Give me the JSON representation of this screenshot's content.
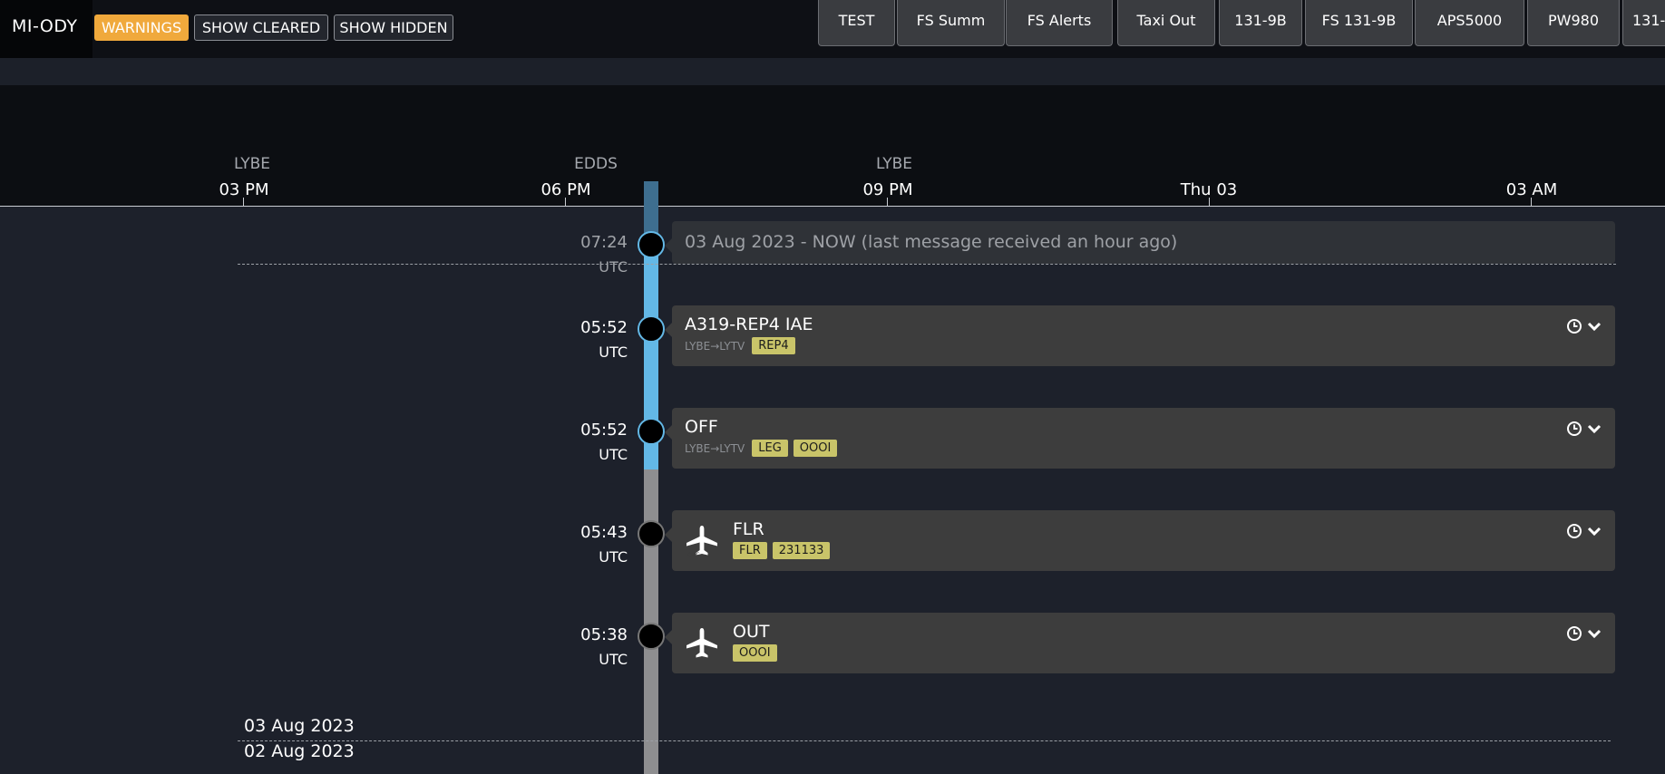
{
  "header": {
    "aircraft": "MI-ODY",
    "filters": [
      "WARNINGS",
      "SHOW CLEARED",
      "SHOW HIDDEN"
    ],
    "tabs": [
      "TEST",
      "FS Summ",
      "FS Alerts",
      "Taxi Out",
      "131-9B",
      "FS 131-9B",
      "APS5000",
      "PW980",
      "131-"
    ]
  },
  "axis": {
    "ticks": [
      {
        "location": "LYBE",
        "time": "03 PM"
      },
      {
        "location": "EDDS",
        "time": "06 PM"
      },
      {
        "location": "LYBE",
        "time": "09 PM"
      },
      {
        "location": "",
        "time": "Thu 03"
      },
      {
        "location": "",
        "time": "03 AM"
      }
    ]
  },
  "timeline": {
    "now": {
      "time": "07:24",
      "tz": "UTC",
      "text": "03 Aug 2023 - NOW (last message received an hour ago)"
    },
    "events": [
      {
        "time": "05:52",
        "tz": "UTC",
        "title": "A319-REP4 IAE",
        "route": "LYBE→LYTV",
        "badges": [
          "REP4"
        ],
        "icon": ""
      },
      {
        "time": "05:52",
        "tz": "UTC",
        "title": "OFF",
        "route": "LYBE→LYTV",
        "badges": [
          "LEG",
          "OOOI"
        ],
        "icon": ""
      },
      {
        "time": "05:43",
        "tz": "UTC",
        "title": "FLR",
        "route": "",
        "badges": [
          "FLR",
          "231133"
        ],
        "icon": "plane-fault-icon"
      },
      {
        "time": "05:38",
        "tz": "UTC",
        "title": "OUT",
        "route": "",
        "badges": [
          "OOOI"
        ],
        "icon": "plane-icon"
      }
    ],
    "day_separator": {
      "above": "03 Aug 2023",
      "below": "02 Aug 2023"
    }
  },
  "colors": {
    "warning": "#f0a93c",
    "badge": "#c9c469",
    "rail_active": "#63b8e6",
    "rail_past": "#8e8e90",
    "background": "#1d212b"
  }
}
